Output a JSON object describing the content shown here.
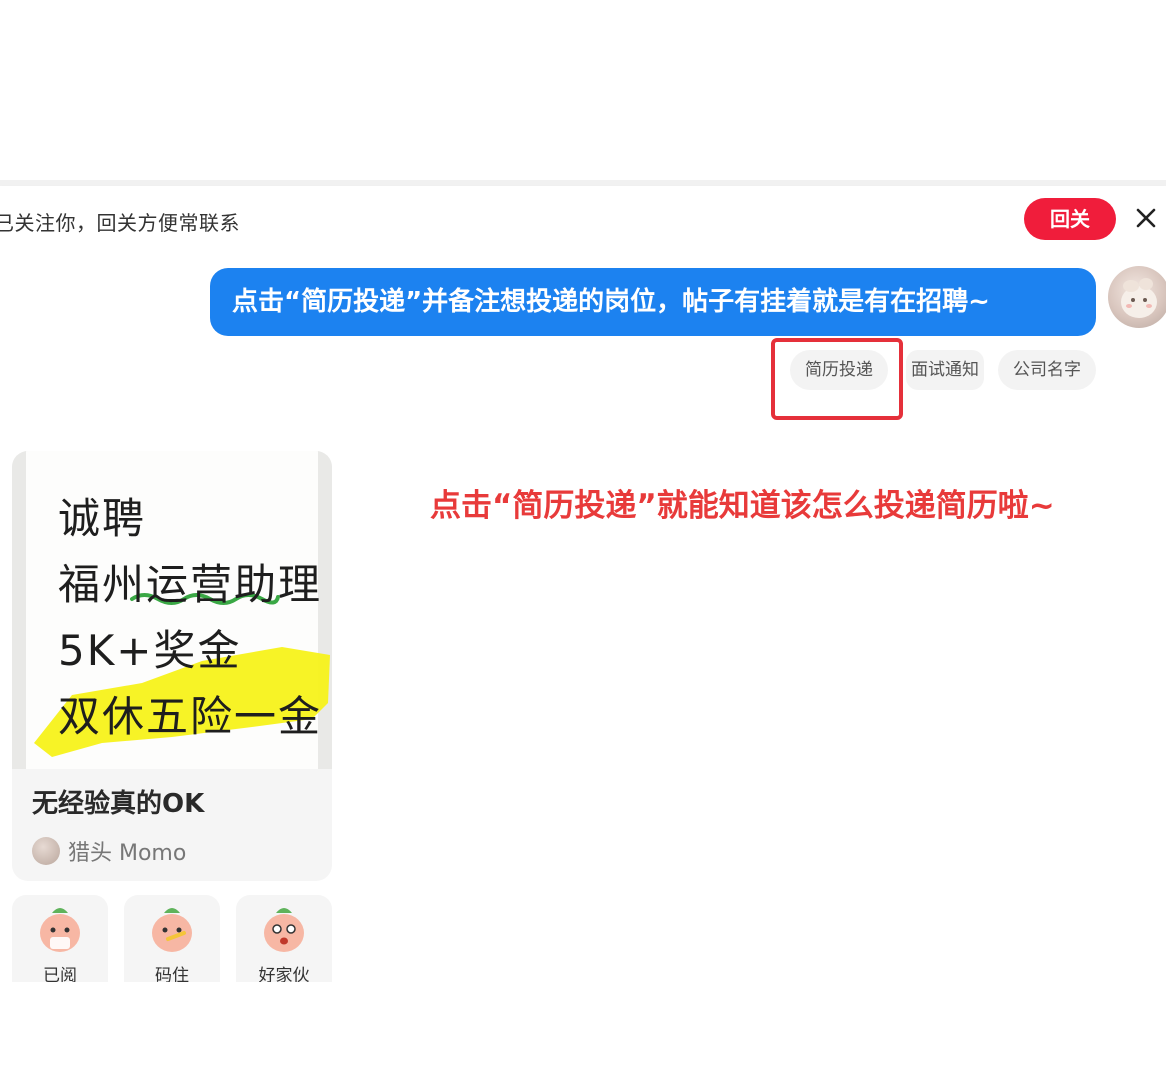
{
  "follow_bar": {
    "notice": "已关注你，回关方便常联系",
    "follow_back_label": "回关"
  },
  "chat": {
    "message": "点击“简历投递”并备注想投递的岗位，帖子有挂着就是有在招聘~",
    "quick_replies": [
      "简历投递",
      "面试通知",
      "公司名字"
    ]
  },
  "annotation": "点击“简历投递”就能知道该怎么投递简历啦~",
  "post_card": {
    "poster_lines": [
      "诚聘",
      "福州运营助理",
      "5K+奖金",
      "双休五险一金"
    ],
    "title": "无经验真的OK",
    "author": "猎头 Momo"
  },
  "stickers": [
    "已阅",
    "码住",
    "好家伙"
  ],
  "colors": {
    "primary_blue": "#1c82f0",
    "follow_red": "#f01d3b",
    "annotation_red": "#e83a3a",
    "highlighter_yellow": "#f7f21a",
    "underline_green": "#3aa845"
  }
}
